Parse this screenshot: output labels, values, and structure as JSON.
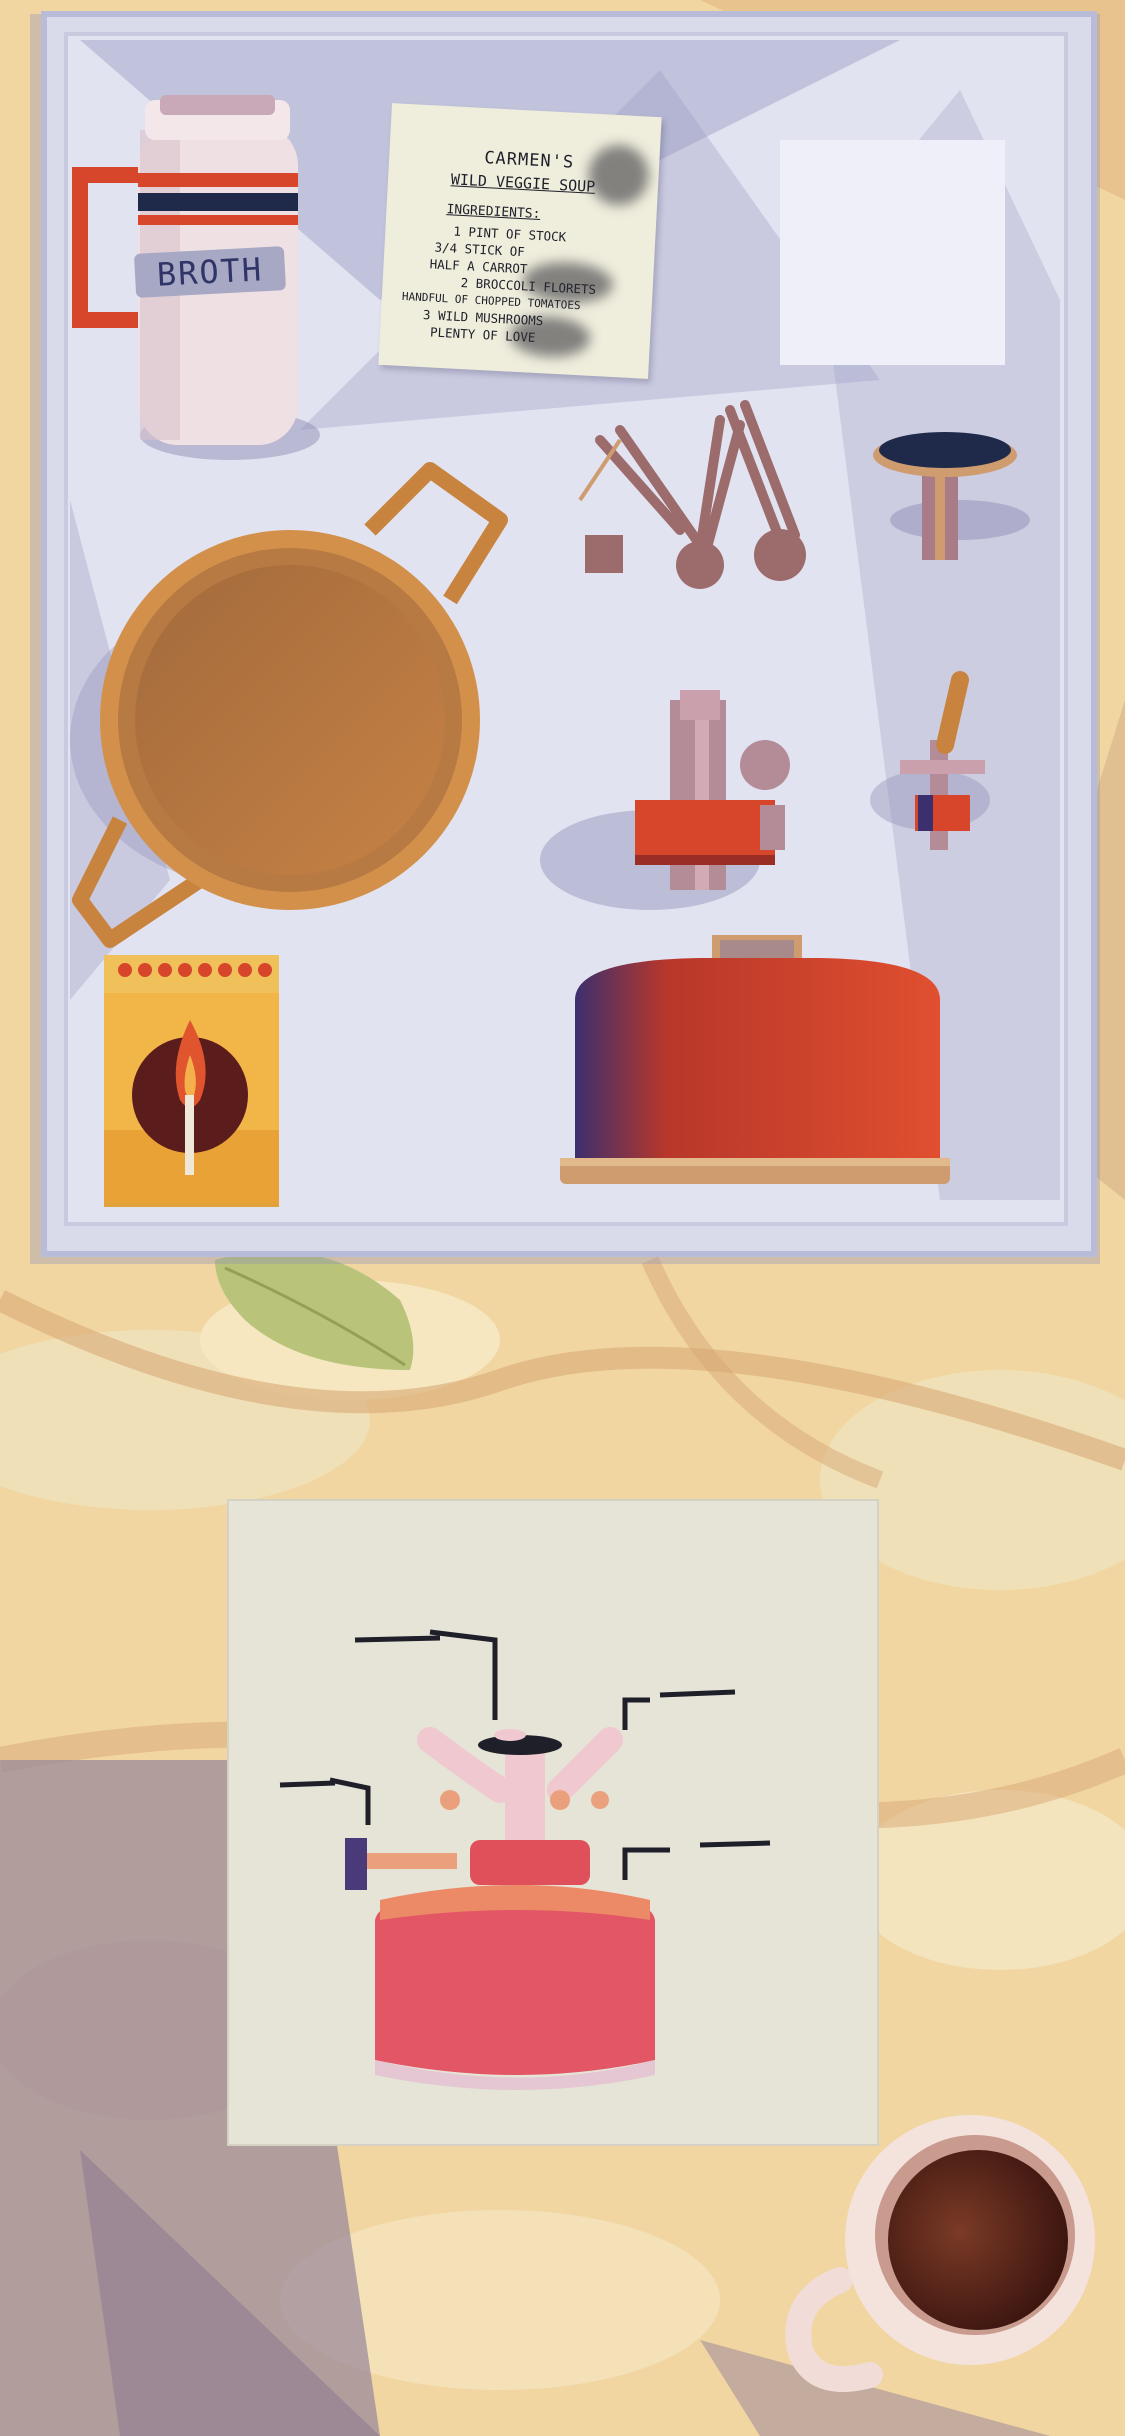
{
  "colors": {
    "table_base": "#f2d8a5",
    "table_dark": "#e4b77e",
    "tray": "#d9dbeb",
    "tray_shadow": "#9b9bc3",
    "accent_red": "#d9452c",
    "copper": "#c8843f",
    "navy": "#1f2a4a"
  },
  "recipe": {
    "title": "CARMEN'S",
    "subtitle": "WILD VEGGIE SOUP",
    "ingredients_heading": "INGREDIENTS:",
    "lines": [
      "1 PINT OF STOCK",
      "3/4 STICK OF",
      "HALF A CARROT",
      "2 BROCCOLI FLORETS",
      "HANDFUL OF CHOPPED TOMATOES",
      "3 WILD MUSHROOMS",
      "PLENTY OF LOVE"
    ]
  },
  "thermos": {
    "label": "BROTH"
  },
  "icons": {
    "thermos": "thermos-icon",
    "pot": "cooking-pot-icon",
    "spoons": "measuring-spoons-icon",
    "knob": "burner-knob-icon",
    "burner": "stove-burner-icon",
    "valve": "gas-valve-icon",
    "canister": "gas-canister-icon",
    "matches": "matchbox-icon",
    "leaf": "leaf-icon",
    "mug": "coffee-mug-icon"
  }
}
